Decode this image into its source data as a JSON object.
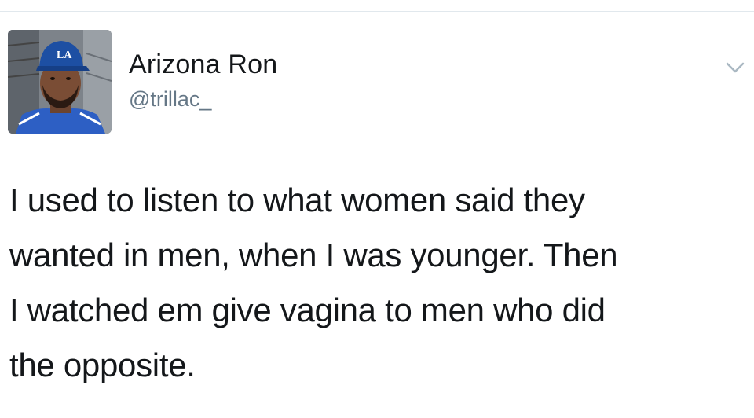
{
  "tweet": {
    "author": {
      "display_name": "Arizona Ron",
      "handle": "@trillac_",
      "avatar_icon": "profile-photo"
    },
    "menu_icon": "chevron-down-icon",
    "text_lines": [
      "I used to listen to what women said they",
      "wanted in men, when I was younger. Then",
      "I watched em give vagina to men who did",
      "the opposite."
    ]
  },
  "colors": {
    "text": "#14171a",
    "handle": "#657786",
    "divider": "#e1e8ed",
    "chevron": "#aab8c2",
    "cap_blue": "#1d4fa3"
  }
}
